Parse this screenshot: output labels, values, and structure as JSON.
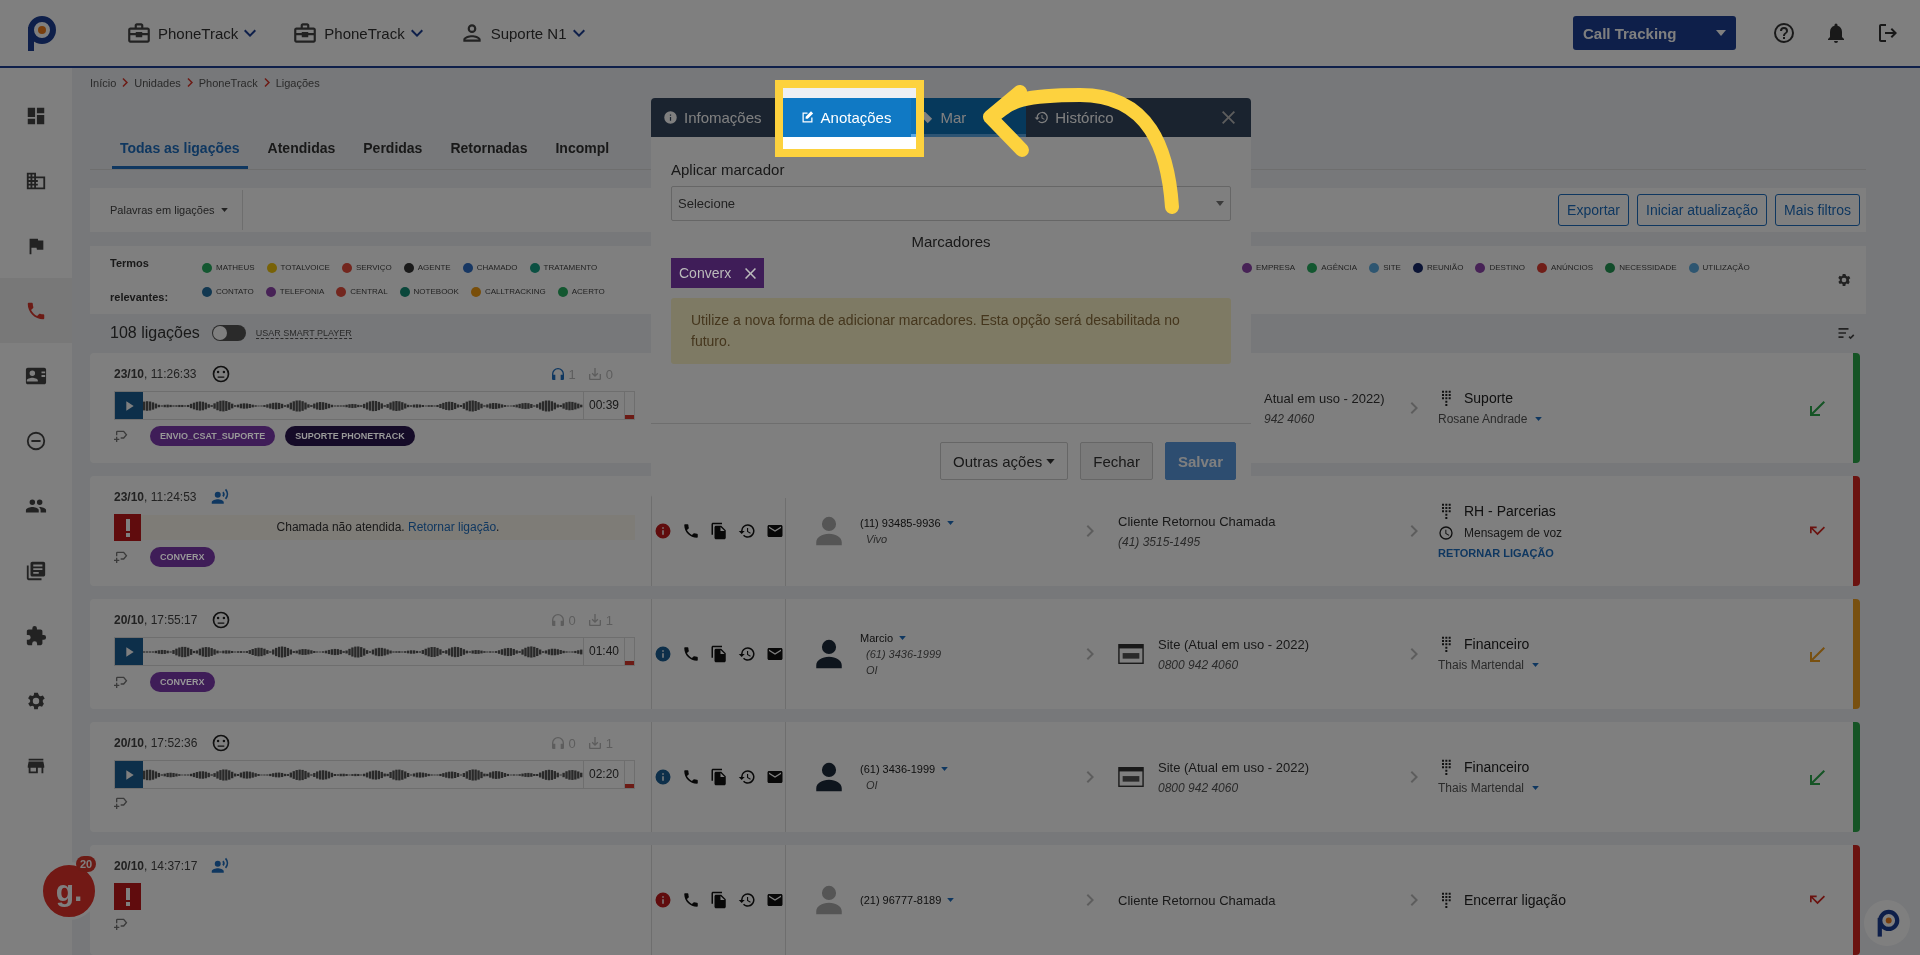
{
  "topbar": {
    "nav": [
      {
        "label": "PhoneTrack"
      },
      {
        "label": "PhoneTrack"
      },
      {
        "label": "Suporte N1"
      }
    ],
    "product_select": "Call Tracking"
  },
  "sidebar": {
    "items": [
      {
        "selected": false
      },
      {
        "selected": false
      },
      {
        "selected": false
      },
      {
        "selected": true
      },
      {
        "selected": false
      },
      {
        "selected": false
      },
      {
        "selected": false
      },
      {
        "selected": false
      },
      {
        "selected": false
      },
      {
        "selected": false
      },
      {
        "selected": false
      }
    ]
  },
  "breadcrumb": [
    "Início",
    "Unidades",
    "PhoneTrack",
    "Ligações"
  ],
  "tabs": [
    {
      "label": "Todas as ligações",
      "selected": true
    },
    {
      "label": "Atendidas",
      "selected": false
    },
    {
      "label": "Perdidas",
      "selected": false
    },
    {
      "label": "Retornadas",
      "selected": false
    },
    {
      "label": "Incompl",
      "selected": false
    }
  ],
  "filters": {
    "keyword_select": "Palavras em ligações",
    "buttons": [
      {
        "label": "Exportar"
      },
      {
        "label": "Iniciar atualização"
      },
      {
        "label": "Mais filtros"
      }
    ]
  },
  "terms": {
    "label": "Termos relevantes:",
    "rows": [
      {
        "left": [
          {
            "label": "MATHEUS",
            "color": "#135730"
          },
          {
            "label": "TOTALVOICE",
            "color": "#786207"
          },
          {
            "label": "SERVIÇO",
            "color": "#73261e"
          },
          {
            "label": "AGENTE",
            "color": "#1a1a1a"
          },
          {
            "label": "CHAMADO",
            "color": "#173763"
          },
          {
            "label": "TRATAMENTO",
            "color": "#0b5042"
          }
        ],
        "right": [
          {
            "label": "EMPRESA",
            "color": "#472256"
          },
          {
            "label": "AGÊNCIA",
            "color": "#135730"
          },
          {
            "label": "SITE",
            "color": "#2e5671"
          },
          {
            "label": "REUNIÃO",
            "color": "#0b1435"
          },
          {
            "label": "DESTINO",
            "color": "#472256"
          },
          {
            "label": "ANÚNCIOS",
            "color": "#701e18"
          },
          {
            "label": "NECESSIDADE",
            "color": "#114c2a"
          },
          {
            "label": "UTILIZAÇÃO",
            "color": "#2e5671"
          }
        ]
      },
      {
        "left": [
          {
            "label": "CONTATO",
            "color": "#123851"
          },
          {
            "label": "TELEFONIA",
            "color": "#472256"
          },
          {
            "label": "CENTRAL",
            "color": "#73261e"
          },
          {
            "label": "NOTEBOOK",
            "color": "#0a473b"
          },
          {
            "label": "CALLTRACKING",
            "color": "#794e09"
          },
          {
            "label": "ACERTO",
            "color": "#135730"
          }
        ],
        "right": []
      }
    ]
  },
  "list_header": {
    "count": "108 ligações",
    "smart_player": {
      "label": "USAR SMART PLAYER",
      "on": false
    }
  },
  "calls": [
    {
      "kind": "recorded",
      "color": "#155425",
      "datetime": "**23/10**, 11:26:33",
      "listens": "1",
      "listened": true,
      "downloads": "0",
      "duration": "00:39",
      "tags": [
        {
          "label": "ENVIO_CSAT_SUPORTE",
          "color": "#3f1d58"
        },
        {
          "label": "SUPORTE PHONETRACK",
          "color": "#150b28"
        }
      ],
      "destination": {
        "kind": "partial",
        "name": "Atual em uso - 2022)",
        "number": "942 4060"
      },
      "department": "Suporte",
      "agent": "Rosane Andrade"
    },
    {
      "kind": "missed",
      "color": "#6b1310",
      "datetime": "**23/10**, 11:24:53",
      "message": "Chamada não atendida.",
      "link": "Retornar ligação",
      "message_end": ".",
      "tags": [
        {
          "label": "CONVERX",
          "color": "#3f1d58"
        }
      ],
      "caller": {
        "kind": "generic",
        "number": "(11) 93485-9936",
        "carrier": "Vivo"
      },
      "destination": {
        "kind": "text",
        "name": "Cliente Retornou Chamada",
        "number": "(41) 3515-1495"
      },
      "department": "RH - Parcerias",
      "voicemail": "Mensagem de voz",
      "action_link": "RETORNAR LIGAÇÃO"
    },
    {
      "kind": "recorded",
      "color": "#785010",
      "datetime": "**20/10**, 17:55:17",
      "listens": "0",
      "listened": false,
      "downloads": "1",
      "duration": "01:40",
      "tags": [
        {
          "label": "CONVERX",
          "color": "#3f1d58"
        }
      ],
      "caller": {
        "kind": "person",
        "name": "Marcio",
        "number": "(61) 3436-1999",
        "carrier": "OI"
      },
      "destination": {
        "kind": "site",
        "name": "Site (Atual em uso - 2022)",
        "number": "0800 942 4060"
      },
      "department": "Financeiro",
      "agent": "Thais Martendal"
    },
    {
      "kind": "recorded",
      "color": "#155425",
      "datetime": "**20/10**, 17:52:36",
      "listens": "0",
      "listened": false,
      "downloads": "1",
      "duration": "02:20",
      "caller": {
        "kind": "person",
        "number": "(61) 3436-1999",
        "carrier": "OI"
      },
      "destination": {
        "kind": "site",
        "name": "Site (Atual em uso - 2022)",
        "number": "0800 942 4060"
      },
      "department": "Financeiro",
      "agent": "Thais Martendal"
    },
    {
      "kind": "missed",
      "color": "#6b1310",
      "datetime": "**20/10**, 14:37:17",
      "caller": {
        "kind": "generic",
        "number": "(21) 96777-8189"
      },
      "destination": {
        "kind": "text",
        "name": "Cliente Retornou Chamada"
      },
      "department": "Encerrar ligação"
    }
  ],
  "floating": {
    "badge_letter": "g.",
    "badge_count": "20"
  },
  "modal": {
    "tabs": [
      {
        "label": "Infomações",
        "selected": false,
        "highlighted": false
      },
      {
        "label": "Anotações",
        "selected": false,
        "highlighted": true
      },
      {
        "label": "Mar",
        "selected": true,
        "highlighted": false
      },
      {
        "label": "Histórico",
        "selected": false,
        "highlighted": false
      }
    ],
    "field_label": "Aplicar marcador",
    "select_value": "Selecione",
    "section_title": "Marcadores",
    "chips": [
      {
        "label": "Converx",
        "color": "#3f1d58"
      }
    ],
    "alert": "Utilize a nova forma de adicionar marcadores. Esta opção será desabilitada no futuro.",
    "buttons": [
      {
        "label": "Outras ações",
        "kind": "dropdown"
      },
      {
        "label": "Fechar",
        "kind": "default"
      },
      {
        "label": "Salvar",
        "kind": "primary"
      }
    ]
  }
}
